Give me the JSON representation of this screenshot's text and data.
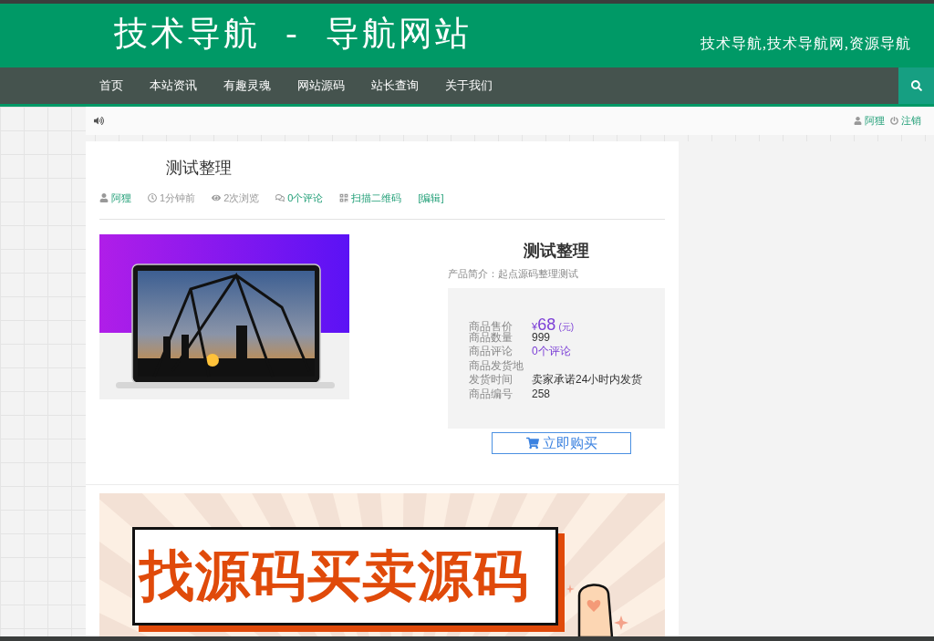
{
  "header": {
    "title": "技术导航 - 导航网站",
    "slogan": "技术导航,技术导航网,资源导航"
  },
  "nav": {
    "items": [
      "首页",
      "本站资讯",
      "有趣灵魂",
      "网站源码",
      "站长查询",
      "关于我们"
    ]
  },
  "user_bar": {
    "user": "阿狸",
    "logout": "注销"
  },
  "article": {
    "title": "测试整理",
    "meta": [
      {
        "kind": "author",
        "text": "阿狸"
      },
      {
        "kind": "time",
        "text": "1分钟前"
      },
      {
        "kind": "views",
        "text": "2次浏览"
      },
      {
        "kind": "comments",
        "text": "0个评论"
      },
      {
        "kind": "qrcode",
        "text": "扫描二维码"
      },
      {
        "kind": "edit",
        "text": "[编辑]"
      }
    ]
  },
  "product": {
    "title": "测试整理",
    "intro": "产品简介：起点源码整理测试",
    "specs": [
      {
        "kind": "price",
        "label": "商品售价",
        "currency": "¥",
        "value": "68",
        "unit": "(元)"
      },
      {
        "kind": "text",
        "label": "商品数量",
        "value": "999"
      },
      {
        "kind": "link",
        "label": "商品评论",
        "value": "0个评论"
      },
      {
        "kind": "text",
        "label": "商品发货地"
      },
      {
        "kind": "text",
        "label": "发货时间",
        "value": "卖家承诺24小时内发货"
      },
      {
        "kind": "text",
        "label": "商品编号",
        "value": "258"
      }
    ],
    "buy_button": "立即购买"
  },
  "banner": {
    "headline": "找源码买卖源码"
  }
}
